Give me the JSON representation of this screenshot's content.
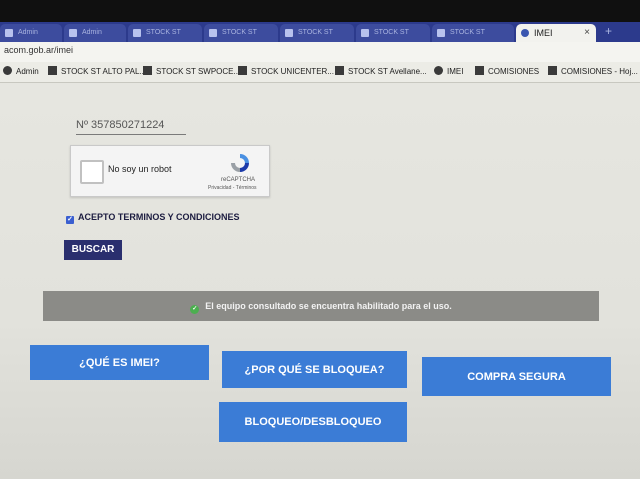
{
  "browser": {
    "tabs": [
      {
        "label": "Admin"
      },
      {
        "label": "Admin"
      },
      {
        "label": "STOCK ST"
      },
      {
        "label": "STOCK ST"
      },
      {
        "label": "STOCK ST"
      },
      {
        "label": "STOCK ST"
      },
      {
        "label": "STOCK ST"
      },
      {
        "label": "IMEI",
        "active": true
      }
    ],
    "close_glyph": "×",
    "new_tab_glyph": "+",
    "url": "acom.gob.ar/imei",
    "bookmarks": [
      {
        "label": "Admin",
        "icon": "gear-icon"
      },
      {
        "label": "STOCK ST ALTO PAL...",
        "icon": "sheet-icon"
      },
      {
        "label": "STOCK ST SWPOCE...",
        "icon": "sheet-icon"
      },
      {
        "label": "STOCK UNICENTER...",
        "icon": "sheet-icon"
      },
      {
        "label": "STOCK ST Avellane...",
        "icon": "sheet-icon"
      },
      {
        "label": "IMEI",
        "icon": "drop-icon"
      },
      {
        "label": "COMISIONES",
        "icon": "sheet-icon"
      },
      {
        "label": "COMISIONES - Hoj...",
        "icon": "sheet-icon"
      }
    ]
  },
  "form": {
    "imei_value": "Nº  357850271224",
    "captcha_label": "No soy un robot",
    "captcha_brand": "reCAPTCHA",
    "captcha_links": "Privacidad - Términos",
    "terms_label": "ACEPTO TERMINOS Y CONDICIONES",
    "search_label": "BUSCAR"
  },
  "result": {
    "message": "El equipo consultado se encuentra habilitado para el uso.",
    "status_color": "#4caf50"
  },
  "actions": {
    "what_is_imei": "¿QUÉ ES IMEI?",
    "why_blocked": "¿POR QUÉ SE BLOQUEA?",
    "safe_purchase": "COMPRA SEGURA",
    "block_unblock": "BLOQUEO/DESBLOQUEO"
  },
  "colors": {
    "tab_bar": "#2c3a8c",
    "button": "#3b7cd6",
    "search_button": "#2a2f6e",
    "status_bar": "#8b8b87"
  }
}
